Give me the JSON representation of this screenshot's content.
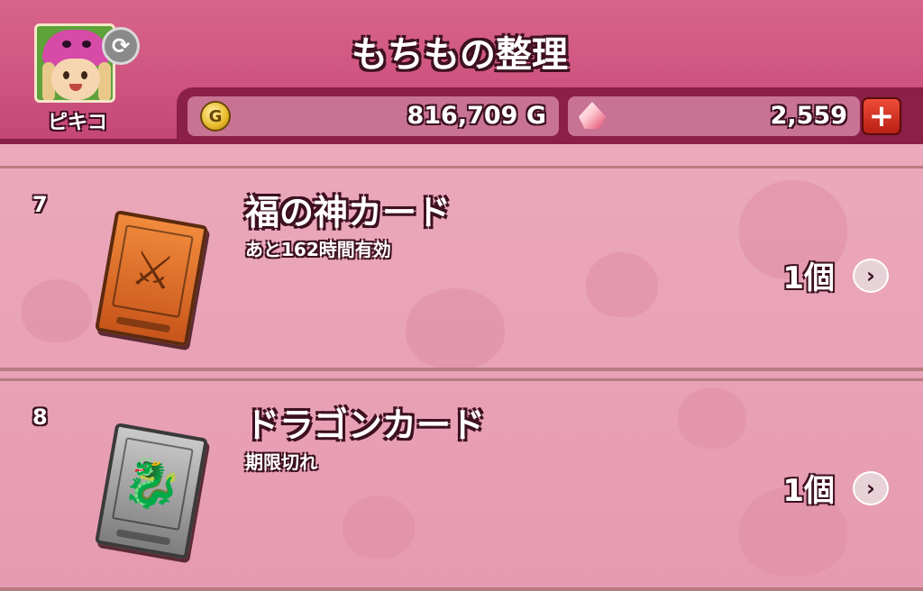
{
  "header": {
    "title": "もちもの整理",
    "player_name": "ピキコ",
    "swap_icon": "refresh-icon",
    "gold": {
      "icon": "gold-coin-icon",
      "coin_glyph": "G",
      "value": "816,709 G"
    },
    "gems": {
      "icon": "gem-icon",
      "value": "2,559",
      "add_label": "+"
    }
  },
  "items": [
    {
      "index": "7",
      "name": "福の神カード",
      "status": "あと162時間有効",
      "count": "1個",
      "icon": "card-orange-icon",
      "card_glyph": "⚔",
      "chevron": "›"
    },
    {
      "index": "8",
      "name": "ドラゴンカード",
      "status": "期限切れ",
      "count": "1個",
      "icon": "card-gray-dragon-icon",
      "card_glyph": "🐉",
      "chevron": "›"
    }
  ],
  "colors": {
    "header_bg": "#cf5480",
    "header_border": "#8a1f47",
    "list_bg": "#e69ab0",
    "divider": "#b87c80"
  }
}
